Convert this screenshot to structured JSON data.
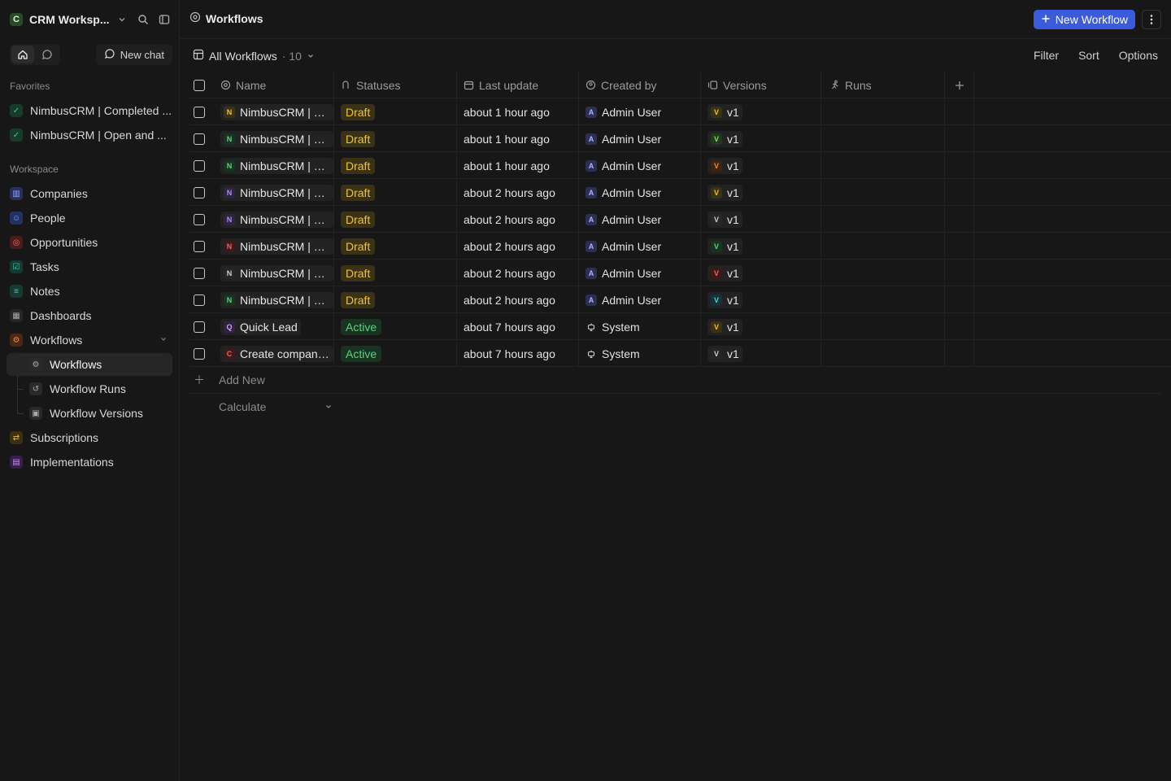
{
  "workspace": {
    "logo_letter": "C",
    "name": "CRM Worksp..."
  },
  "nav_top": {
    "new_chat_label": "New chat"
  },
  "sidebar": {
    "favorites_label": "Favorites",
    "favorites": [
      {
        "label": "NimbusCRM | Completed ..."
      },
      {
        "label": "NimbusCRM | Open and ..."
      }
    ],
    "workspace_label": "Workspace",
    "items": [
      {
        "label": "Companies",
        "icon": "building-icon",
        "color": "#4a63c9"
      },
      {
        "label": "People",
        "icon": "person-icon",
        "color": "#3e62d6"
      },
      {
        "label": "Opportunities",
        "icon": "target-icon",
        "color": "#d64848"
      },
      {
        "label": "Tasks",
        "icon": "checkbox-icon",
        "color": "#1f9e7a"
      },
      {
        "label": "Notes",
        "icon": "note-icon",
        "color": "#1f9e7a"
      },
      {
        "label": "Dashboards",
        "icon": "grid-icon",
        "color": "#8a8a8a"
      },
      {
        "label": "Workflows",
        "icon": "settings-automation-icon",
        "color": "#e06a2c"
      },
      {
        "label": "Workflows",
        "icon": "settings-automation-icon",
        "color": "#9a9a9a"
      },
      {
        "label": "Workflow Runs",
        "icon": "history-icon",
        "color": "#9a9a9a"
      },
      {
        "label": "Workflow Versions",
        "icon": "versions-icon",
        "color": "#9a9a9a"
      },
      {
        "label": "Subscriptions",
        "icon": "repeat-icon",
        "color": "#d49a1f"
      },
      {
        "label": "Implementations",
        "icon": "document-icon",
        "color": "#9b59b6"
      }
    ]
  },
  "header": {
    "title": "Workflows",
    "new_button_label": "New Workflow"
  },
  "view": {
    "name": "All Workflows",
    "count": "· 10",
    "filter": "Filter",
    "sort": "Sort",
    "options": "Options"
  },
  "columns": {
    "name": "Name",
    "status": "Statuses",
    "updated": "Last update",
    "creator": "Created by",
    "versions": "Versions",
    "runs": "Runs"
  },
  "rows": [
    {
      "avatar": "N",
      "avatar_bg": "#3a3216",
      "avatar_fg": "#f1c232",
      "name": "NimbusCRM | Dra...",
      "status": "Draft",
      "updated": "about 1 hour ago",
      "creator_initial": "A",
      "creator": "Admin User",
      "ver_letter": "V",
      "ver_bg": "#3a3216",
      "ver_fg": "#f1c232",
      "version": "v1"
    },
    {
      "avatar": "N",
      "avatar_bg": "#183320",
      "avatar_fg": "#5fd184",
      "name": "NimbusCRM | Dra...",
      "status": "Draft",
      "updated": "about 1 hour ago",
      "creator_initial": "A",
      "creator": "Admin User",
      "ver_letter": "V",
      "ver_bg": "#1f3a1f",
      "ver_fg": "#8fd46a",
      "version": "v1"
    },
    {
      "avatar": "N",
      "avatar_bg": "#183320",
      "avatar_fg": "#5fd184",
      "name": "NimbusCRM | Dra...",
      "status": "Draft",
      "updated": "about 1 hour ago",
      "creator_initial": "A",
      "creator": "Admin User",
      "ver_letter": "V",
      "ver_bg": "#3d2410",
      "ver_fg": "#f08a3c",
      "version": "v1"
    },
    {
      "avatar": "N",
      "avatar_bg": "#2e2440",
      "avatar_fg": "#b38cf0",
      "name": "NimbusCRM | Dra...",
      "status": "Draft",
      "updated": "about 2 hours ago",
      "creator_initial": "A",
      "creator": "Admin User",
      "ver_letter": "V",
      "ver_bg": "#3a3216",
      "ver_fg": "#f1c232",
      "version": "v1"
    },
    {
      "avatar": "N",
      "avatar_bg": "#2e2440",
      "avatar_fg": "#b38cf0",
      "name": "NimbusCRM | Dra...",
      "status": "Draft",
      "updated": "about 2 hours ago",
      "creator_initial": "A",
      "creator": "Admin User",
      "ver_letter": "V",
      "ver_bg": "#262626",
      "ver_fg": "#cfcfcf",
      "version": "v1"
    },
    {
      "avatar": "N",
      "avatar_bg": "#3d1a1a",
      "avatar_fg": "#f06262",
      "name": "NimbusCRM | Dra...",
      "status": "Draft",
      "updated": "about 2 hours ago",
      "creator_initial": "A",
      "creator": "Admin User",
      "ver_letter": "V",
      "ver_bg": "#183320",
      "ver_fg": "#5fd184",
      "version": "v1"
    },
    {
      "avatar": "N",
      "avatar_bg": "#262626",
      "avatar_fg": "#cfcfcf",
      "name": "NimbusCRM | Dra...",
      "status": "Draft",
      "updated": "about 2 hours ago",
      "creator_initial": "A",
      "creator": "Admin User",
      "ver_letter": "V",
      "ver_bg": "#3d1a1a",
      "ver_fg": "#f06262",
      "version": "v1"
    },
    {
      "avatar": "N",
      "avatar_bg": "#183320",
      "avatar_fg": "#5fd184",
      "name": "NimbusCRM | Dra...",
      "status": "Draft",
      "updated": "about 2 hours ago",
      "creator_initial": "A",
      "creator": "Admin User",
      "ver_letter": "V",
      "ver_bg": "#163236",
      "ver_fg": "#4fd1d9",
      "version": "v1"
    },
    {
      "avatar": "Q",
      "avatar_bg": "#2e2440",
      "avatar_fg": "#d79cf5",
      "name": "Quick Lead",
      "status": "Active",
      "updated": "about 7 hours ago",
      "creator_initial": "",
      "creator": "System",
      "ver_letter": "V",
      "ver_bg": "#3a3216",
      "ver_fg": "#f1c232",
      "version": "v1"
    },
    {
      "avatar": "C",
      "avatar_bg": "#3d1a1a",
      "avatar_fg": "#f06262",
      "name": "Create company ...",
      "status": "Active",
      "updated": "about 7 hours ago",
      "creator_initial": "",
      "creator": "System",
      "ver_letter": "V",
      "ver_bg": "#262626",
      "ver_fg": "#cfcfcf",
      "version": "v1"
    }
  ],
  "footer": {
    "add_new": "Add New",
    "calculate": "Calculate"
  }
}
